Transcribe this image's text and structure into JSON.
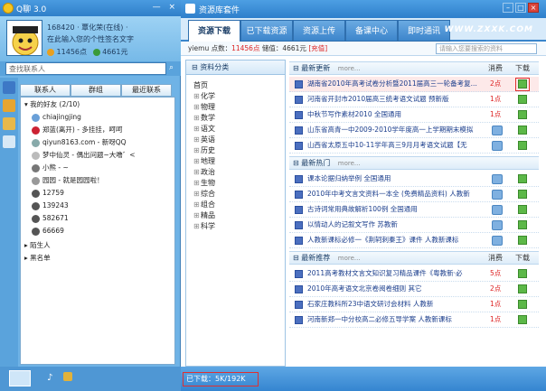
{
  "left_window": {
    "title": "Q聊 3.0",
    "controls": "—  ×",
    "profile": {
      "id_status": "168420  ·  覃化荣(在线) ·",
      "signature": "在此输入您的个性签名文字",
      "points": "11456点",
      "points2": "4661元"
    },
    "search_placeholder": "查找联系人",
    "tabs": [
      "联系人",
      "群组",
      "最近联系"
    ],
    "groups": {
      "friends": "我的好友 (2/10)",
      "strangers": "陌生人",
      "blacklist": "黑名单"
    },
    "contacts": [
      {
        "name": "chiajingjing",
        "status": ""
      },
      {
        "name": "郑蓝(离开) - 多挂挂，呵呵",
        "status": "away"
      },
      {
        "name": "qiyun8163.com - 新呀QQ",
        "status": ""
      },
      {
        "name": "梦中仙灵 - 偶出问题~大噜゛<",
        "status": ""
      },
      {
        "name": "小熊 - ~",
        "status": ""
      },
      {
        "name": "园园 - 就是园园啦！",
        "status": ""
      },
      {
        "name": "12759",
        "status": ""
      },
      {
        "name": "139243",
        "status": ""
      },
      {
        "name": "582671",
        "status": ""
      },
      {
        "name": "66669",
        "status": ""
      }
    ]
  },
  "right_window": {
    "title": "资源库套件",
    "watermark": "WWW.ZXXK.COM",
    "tabs": [
      {
        "label": "资源下载",
        "active": true
      },
      {
        "label": "已下载资源",
        "active": false
      },
      {
        "label": "资源上传",
        "active": false
      },
      {
        "label": "备课中心",
        "active": false
      },
      {
        "label": "即时通讯",
        "active": false
      }
    ],
    "info": {
      "user": "yiemu",
      "points_label": "点数：",
      "points": "11456点",
      "value_label": "储值：",
      "value": "4661元",
      "recharge": "[充值]"
    },
    "search_placeholder": "请输入您要搜索的资料",
    "category_title": "资料分类",
    "categories": [
      "首页",
      "化学",
      "物理",
      "数学",
      "语文",
      "英语",
      "历史",
      "地理",
      "政治",
      "生物",
      "综合",
      "组合",
      "精品",
      "科学"
    ],
    "col_points": "消费",
    "col_download": "下载",
    "sections": [
      {
        "title": "最新更新",
        "more": "more...",
        "items": [
          {
            "title": "湖南省2010年高考试卷分析暨2011届高三一轮备考复...",
            "cost": "2点",
            "selected": true
          },
          {
            "title": "河南省开封市2010届高三统考语文试题 预新版",
            "cost": "1点",
            "selected": false
          },
          {
            "title": "中秋节写作素材2010 全国通用",
            "cost": "1点",
            "selected": false
          },
          {
            "title": "山东省高青一中2009-2010学年度高一上学期期末模拟",
            "cost": "",
            "selected": false
          },
          {
            "title": "山西省太原五中10-11学年高三9月月考语文试题【无",
            "cost": "",
            "selected": false
          }
        ]
      },
      {
        "title": "最新热门",
        "more": "more...",
        "items": [
          {
            "title": "课本论据归纳举例 全国通用",
            "cost": "",
            "selected": false
          },
          {
            "title": "2010年中考文言文资料一本全 (免费精品资料) 人教新",
            "cost": "",
            "selected": false
          },
          {
            "title": "古诗词常用典故解析100例 全国通用",
            "cost": "",
            "selected": false
          },
          {
            "title": "以情动人的记叙文写作 苏教新",
            "cost": "",
            "selected": false
          },
          {
            "title": "人教新课标必修一《荆轲刺秦王》课件 人教新课标",
            "cost": "",
            "selected": false
          }
        ]
      },
      {
        "title": "最新推荐",
        "more": "more...",
        "items": [
          {
            "title": "2011高考教材文言文知识复习精品课件《粤教新·必",
            "cost": "5点",
            "selected": false
          },
          {
            "title": "2010年高考语文北京卷阅卷细则 其它",
            "cost": "2点",
            "selected": false
          },
          {
            "title": "石家庄教科所23中语文研讨会材料 人教新",
            "cost": "1点",
            "selected": false
          },
          {
            "title": "河南新郑一中分校高二必修五导学案 人教新课标",
            "cost": "1点",
            "selected": false
          }
        ]
      }
    ],
    "status": "已下载：5K/192K"
  }
}
